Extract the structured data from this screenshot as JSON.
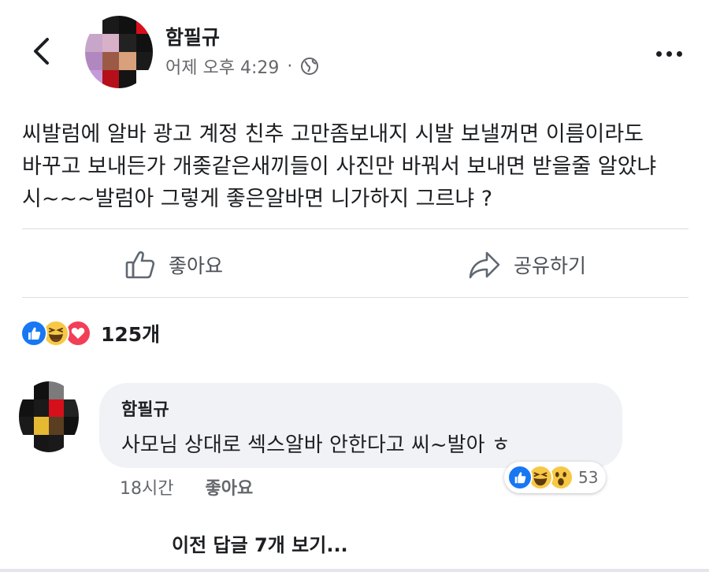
{
  "post": {
    "author": "함필규",
    "timestamp": "어제 오후 4:29",
    "separator": "·",
    "privacy_icon": "globe-icon",
    "text": "씨발럼에 알바 광고 계정 친추 고만좀보내지 시발 보낼꺼면 이름이라도\n바꾸고 보내든가 개좆같은새끼들이 사진만 바꿔서 보내면 받을줄 알았냐\n시~~~발럼아 그렇게 좋은알바면 니가하지 그르냐 ?"
  },
  "actions": {
    "like_label": "좋아요",
    "share_label": "공유하기"
  },
  "reactions": {
    "icons": [
      "like-icon",
      "haha-icon",
      "love-icon"
    ],
    "count": "125개"
  },
  "comment": {
    "author": "함필규",
    "text": "사모님 상대로 섹스알바 안한다고 씨~발아 ㅎ",
    "time": "18시간",
    "like_label": "좋아요",
    "reaction_icons": [
      "like-icon",
      "haha-icon",
      "wow-icon"
    ],
    "reaction_count": "53"
  },
  "prev_replies": "이전 답글 7개 보기...",
  "colors": {
    "like_blue": "#1877f2",
    "love_red": "#f33e58",
    "emoji_yellow": "#f7c845",
    "text": "#1c1e21",
    "secondary": "#65676b",
    "bubble": "#f0f2f5"
  }
}
